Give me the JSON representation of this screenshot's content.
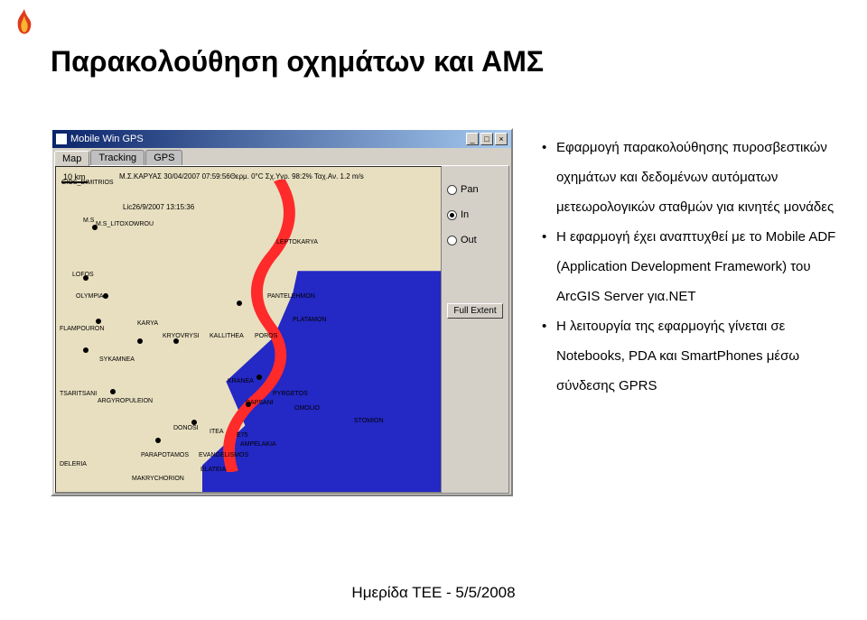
{
  "title": "Παρακολούθηση οχημάτων και ΑΜΣ",
  "window": {
    "title": "Mobile Win GPS",
    "tabs": [
      "Map",
      "Tracking",
      "GPS"
    ],
    "scale": "10 km",
    "info1": "Μ.Σ.ΚΑΡΥΑΣ 30/04/2007 07:59:56Θερμ. 0°C Σχ.Υγρ. 98:2% Ταχ.Αν. 1.2 m/s",
    "info2": "Lic26/9/2007 13:15:36",
    "controls": {
      "pan": "Pan",
      "in": "In",
      "out": "Out",
      "full": "Full Extent"
    },
    "labels": [
      "GIOS_DIMITRIOS",
      "M.S_LITOXOWROU",
      "LEPTOKARYA",
      "LOFOS",
      "OLYMPIAS",
      "FLAMPOURON",
      "KARYA",
      "KRYOVRYSI",
      "KALLITHEA",
      "POROS",
      "PANTELEHMON",
      "PLATAMON",
      "SYKAMNEA",
      "KRANEA",
      "PYRGETOS",
      "TSARITSANI",
      "ARGYROPULEION",
      "DONOSI",
      "ITEA",
      "E75",
      "RAPSANI",
      "OMOLIO",
      "STOMION",
      "AMPELAKIA",
      "DELERIA",
      "PARAPOTAMOS",
      "EVANGELISMOS",
      "ELATEIA",
      "MAKRYCHORION",
      "M.S"
    ]
  },
  "bullets": {
    "line1": "Εφαρμογή παρακολούθησης πυροσβεστικών",
    "line2": "οχημάτων και δεδομένων αυτόματων",
    "line3": "μετεωρολογικών σταθμών για κινητές μονάδες",
    "line4": "Η εφαρμογή έχει αναπτυχθεί με το Mobile ADF",
    "line5": "(Application Development Framework) του",
    "line6": "ArcGIS Server για.NET",
    "line7": "Η λειτουργία της εφαρμογής γίνεται σε",
    "line8": "Notebooks, PDA και SmartPhones μέσω",
    "line9": "σύνδεσης GPRS"
  },
  "footer": "Ημερίδα ΤΕΕ - 5/5/2008"
}
